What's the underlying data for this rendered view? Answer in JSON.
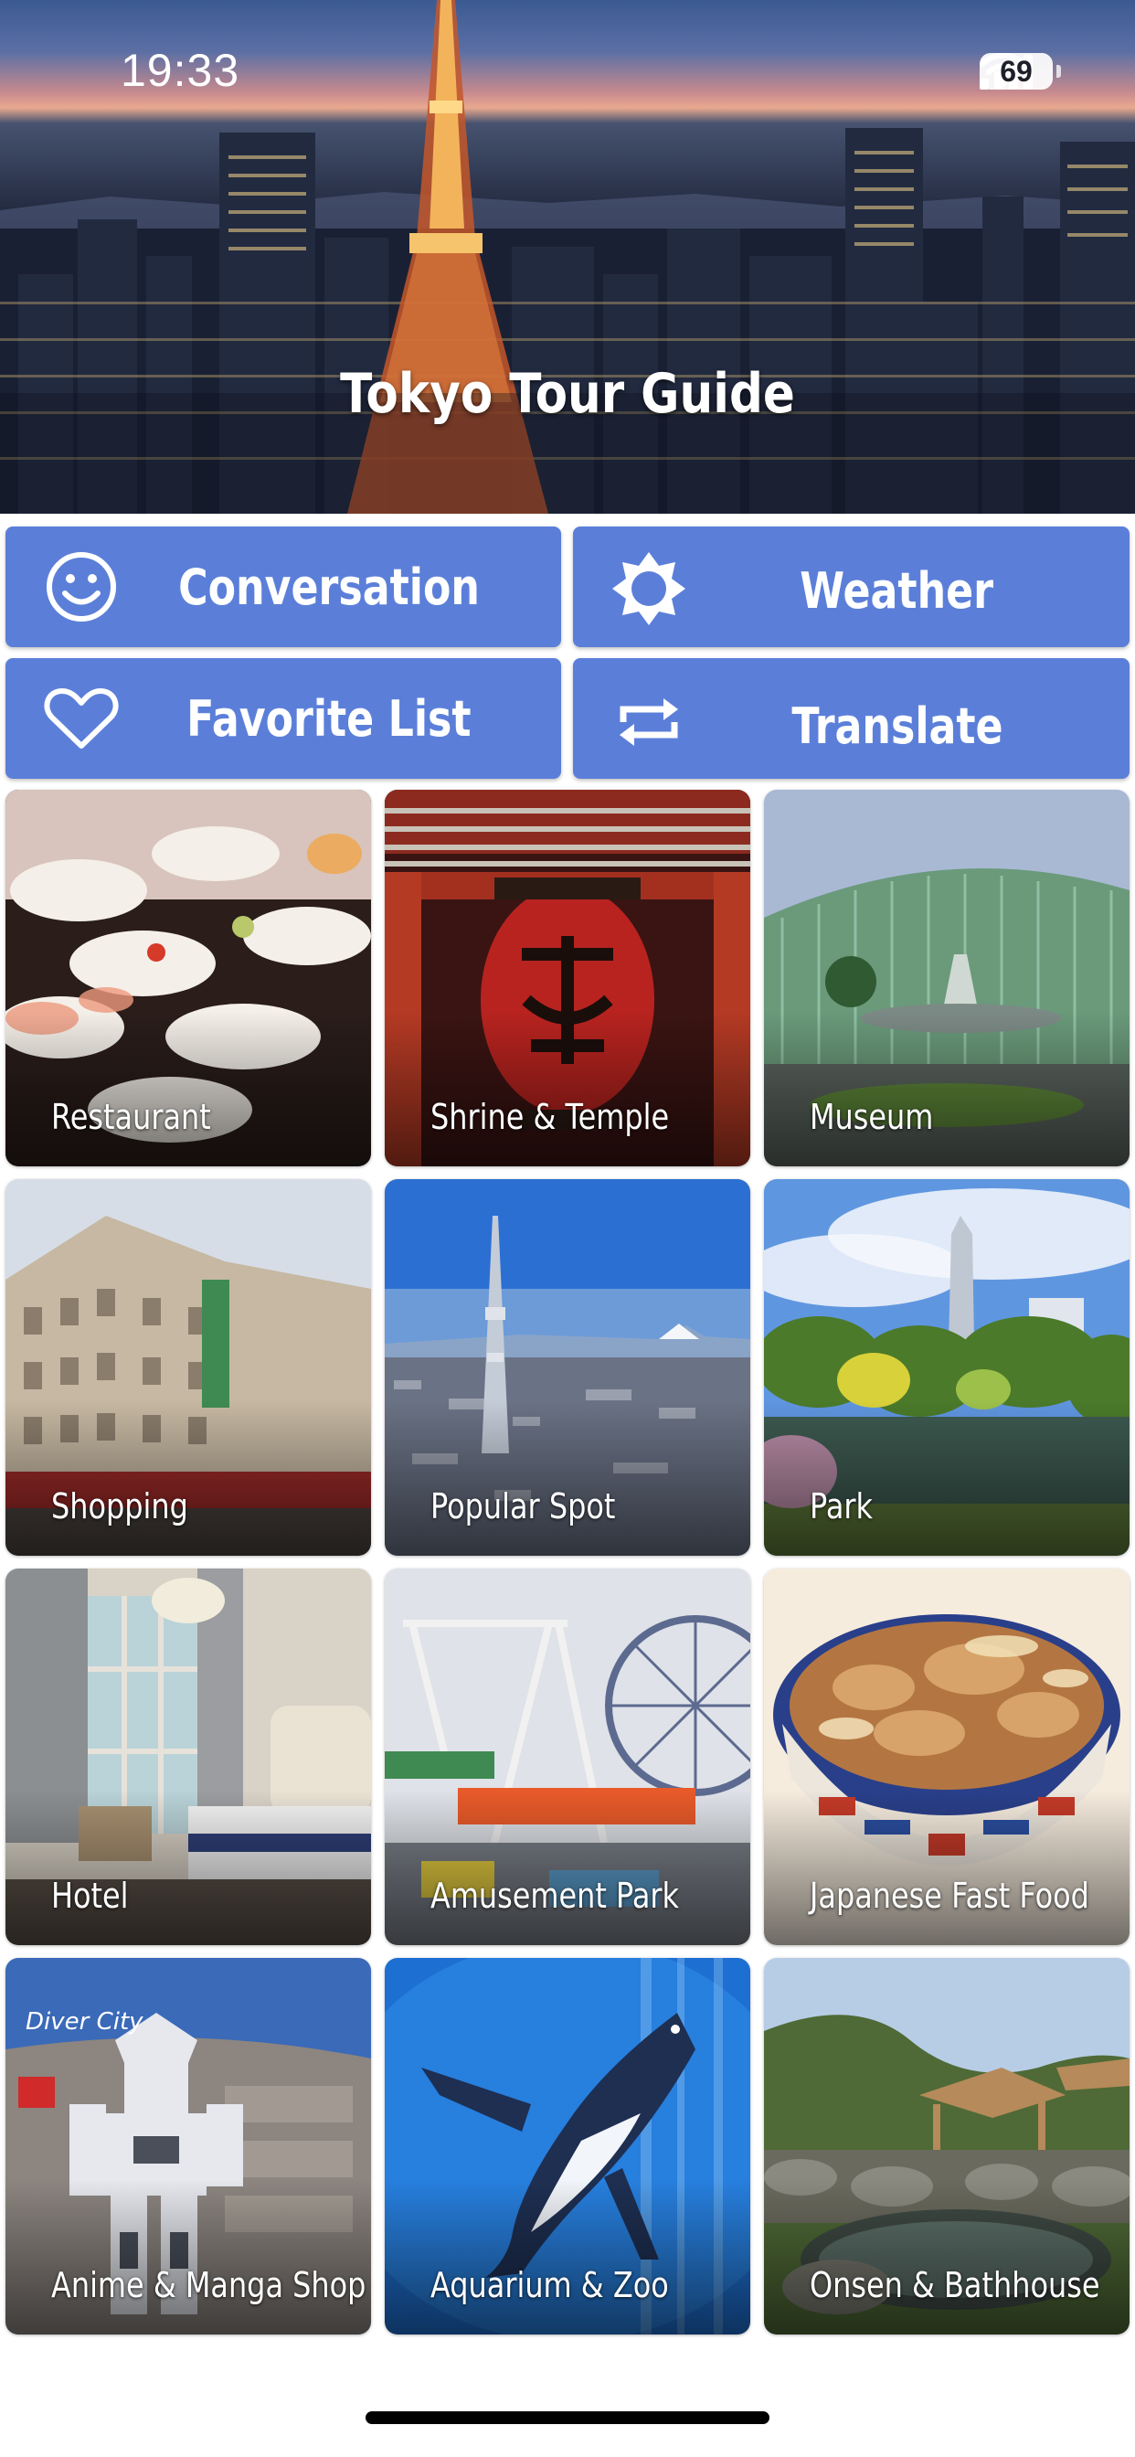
{
  "status_bar": {
    "time": "19:33",
    "battery": "69"
  },
  "header": {
    "title": "Tokyo Tour Guide"
  },
  "actions": [
    {
      "label": "Conversation",
      "icon": "smiley-icon"
    },
    {
      "label": "Weather",
      "icon": "sun-icon"
    },
    {
      "label": "Favorite List",
      "icon": "heart-icon"
    },
    {
      "label": "Translate",
      "icon": "repeat-icon"
    }
  ],
  "categories": [
    {
      "label": "Restaurant"
    },
    {
      "label": "Shrine & Temple"
    },
    {
      "label": "Museum"
    },
    {
      "label": "Shopping"
    },
    {
      "label": "Popular Spot"
    },
    {
      "label": "Park"
    },
    {
      "label": "Hotel"
    },
    {
      "label": "Amusement Park"
    },
    {
      "label": "Japanese Fast Food"
    },
    {
      "label": "Anime & Manga Shop"
    },
    {
      "label": "Aquarium & Zoo"
    },
    {
      "label": "Onsen & Bathhouse"
    }
  ],
  "colors": {
    "accent": "#5b7fd9",
    "button_text": "#ffffff"
  }
}
